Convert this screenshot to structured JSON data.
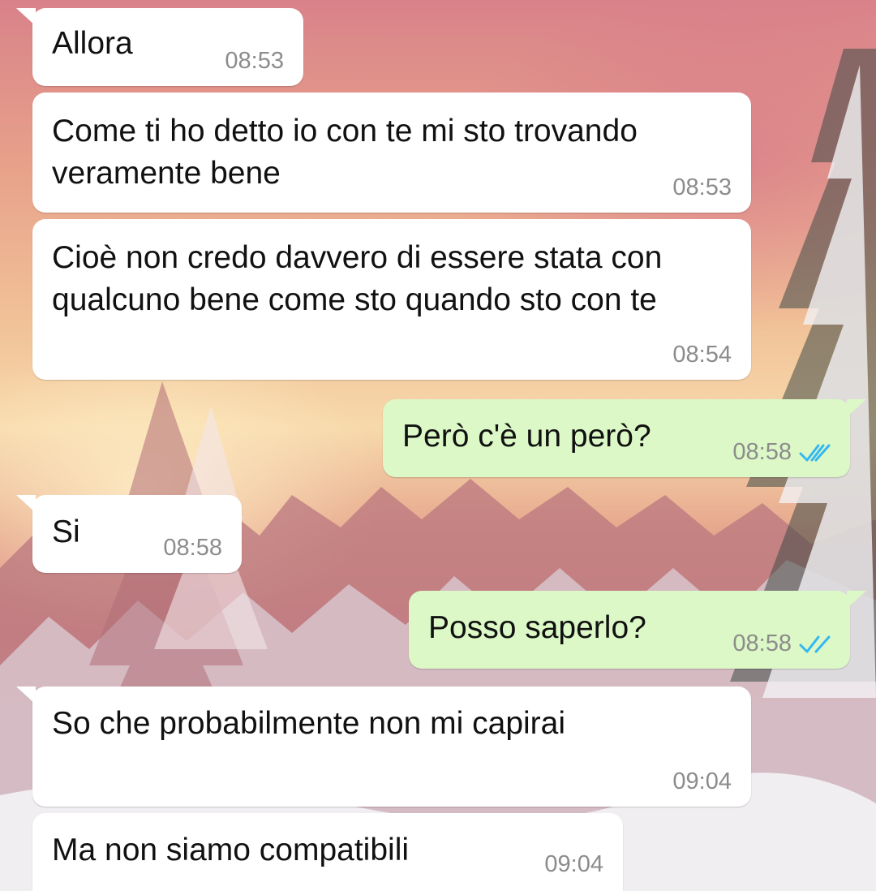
{
  "chat": {
    "messages": [
      {
        "direction": "incoming",
        "text": "Allora",
        "time": "08:53"
      },
      {
        "direction": "incoming",
        "text": "Come ti ho detto io con te mi sto trovando\nveramente bene",
        "time": "08:53"
      },
      {
        "direction": "incoming",
        "text": "Cioè non credo davvero di essere stata con\nqualcuno bene come sto quando sto con te",
        "time": "08:54"
      },
      {
        "direction": "outgoing",
        "text": "Però c'è un però?",
        "time": "08:58",
        "status": "read-double-check-icon"
      },
      {
        "direction": "incoming",
        "text": "Si",
        "time": "08:58"
      },
      {
        "direction": "outgoing",
        "text": "Posso saperlo?",
        "time": "08:58",
        "status": "read-double-check-icon"
      },
      {
        "direction": "incoming",
        "text": "So che probabilmente non mi capirai",
        "time": "09:04"
      },
      {
        "direction": "incoming",
        "text": "Ma non siamo compatibili",
        "time": "09:04"
      }
    ]
  },
  "colors": {
    "incoming_bubble": "#ffffff",
    "outgoing_bubble": "#dcf8c6",
    "timestamp": "#8c8c8c",
    "read_ticks": "#34b7f1"
  }
}
